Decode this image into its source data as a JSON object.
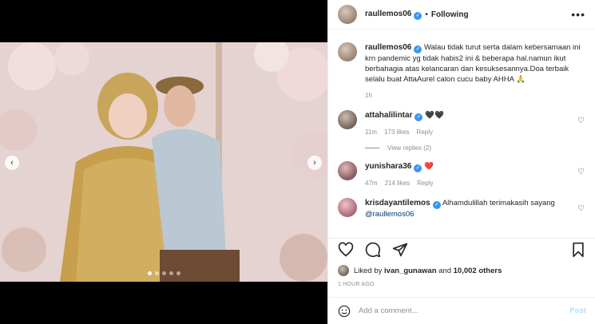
{
  "post": {
    "author": "raullemos06",
    "following_label": "Following",
    "more_label": "•••",
    "caption": "Walau tidak turut serta dalam kebersamaan ini krn pandemic yg tidak habis2 ini & beberapa hal.namun ikut berbahagia atas kelancaran dan kesuksesannya.Doa terbaik selalu buat AttaAurel calon cucu baby AHHA 🙏",
    "caption_time": "1h"
  },
  "comments": [
    {
      "username": "attahalilintar",
      "text": "🖤🖤",
      "time": "11m",
      "likes": "173 likes",
      "reply": "Reply",
      "view_replies": "View replies (2)"
    },
    {
      "username": "yunishara36",
      "text": "❤️",
      "time": "47m",
      "likes": "214 likes",
      "reply": "Reply"
    },
    {
      "username": "krisdayantilemos",
      "text": "Alhamdulillah terimakasih sayang",
      "mention": "@raullemos06"
    }
  ],
  "likes": {
    "prefix": "Liked by",
    "user": "ivan_gunawan",
    "middle": "and",
    "count": "10,002 others"
  },
  "time_ago": "1 HOUR AGO",
  "comment_box": {
    "placeholder": "Add a comment...",
    "post_label": "Post"
  },
  "carousel": {
    "prev": "‹",
    "next": "›",
    "slides": 5,
    "active": 1
  },
  "icons": {
    "verified": "verified-badge-icon",
    "heart": "heart-outline-icon",
    "comment": "comment-bubble-icon",
    "share": "paper-plane-icon",
    "bookmark": "bookmark-icon",
    "emoji": "smiley-icon"
  }
}
